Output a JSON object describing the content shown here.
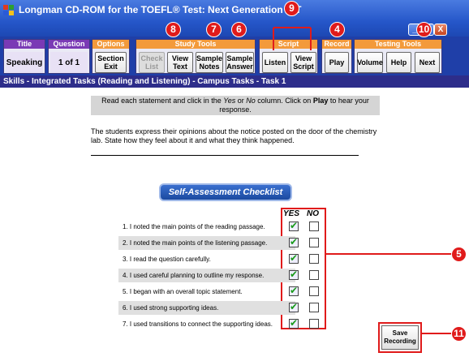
{
  "window": {
    "title": "Longman CD-ROM for the TOEFL® Test: Next Generation iBT",
    "minimize": "_",
    "maximize": "□",
    "close": "X"
  },
  "toolbar": {
    "title_group": {
      "heading": "Title",
      "value": "Speaking"
    },
    "question_group": {
      "heading": "Question",
      "value": "1 of 1"
    },
    "options_group": {
      "heading": "Options",
      "section_exit": "Section Exit"
    },
    "study_tools": {
      "heading": "Study Tools",
      "check_list": "Check List",
      "view_text": "View Text",
      "sample_notes": "Sample Notes",
      "sample_answer": "Sample Answer"
    },
    "script": {
      "heading": "Script",
      "listen": "Listen",
      "view_script": "View Script"
    },
    "record": {
      "heading": "Record",
      "play": "Play"
    },
    "testing_tools": {
      "heading": "Testing Tools",
      "volume": "Volume",
      "help": "Help",
      "next": "Next"
    }
  },
  "callouts": {
    "view_text": "8",
    "sample_notes": "7",
    "sample_answer": "6",
    "script": "9",
    "play": "4",
    "next": "10",
    "checkboxes": "5",
    "save": "11"
  },
  "breadcrumb": "Skills - Integrated Tasks (Reading and Listening) -  Campus Tasks - Task 1",
  "instruction": {
    "part1": "Read each statement and click in the ",
    "yes": "Yes",
    "part2": " or ",
    "no": "No",
    "part3": " column. Click on ",
    "play": "Play",
    "part4": " to hear your response."
  },
  "prompt": "The students express their opinions about the notice posted on the door of the chemistry lab. State how they feel about it and what they think happened.",
  "checklist": {
    "heading": "Self-Assessment Checklist",
    "yes_label": "YES",
    "no_label": "NO",
    "items": [
      {
        "text": "1. I noted the main points of the reading passage.",
        "yes": true,
        "no": false
      },
      {
        "text": "2. I noted the main points of the listening passage.",
        "yes": true,
        "no": false
      },
      {
        "text": "3. I read the question carefully.",
        "yes": true,
        "no": false
      },
      {
        "text": "4. I used careful planning to outline my response.",
        "yes": true,
        "no": false
      },
      {
        "text": "5. I began with an overall topic statement.",
        "yes": true,
        "no": false
      },
      {
        "text": "6. I used strong supporting ideas.",
        "yes": true,
        "no": false
      },
      {
        "text": "7. I used transitions to connect the supporting ideas.",
        "yes": true,
        "no": false
      }
    ]
  },
  "save_recording": "Save Recording",
  "colors": {
    "callout": "#e01b1b",
    "toolbar": "#1f3fa8",
    "purple_header": "#7a3ab5",
    "orange_header": "#f39a3b"
  }
}
